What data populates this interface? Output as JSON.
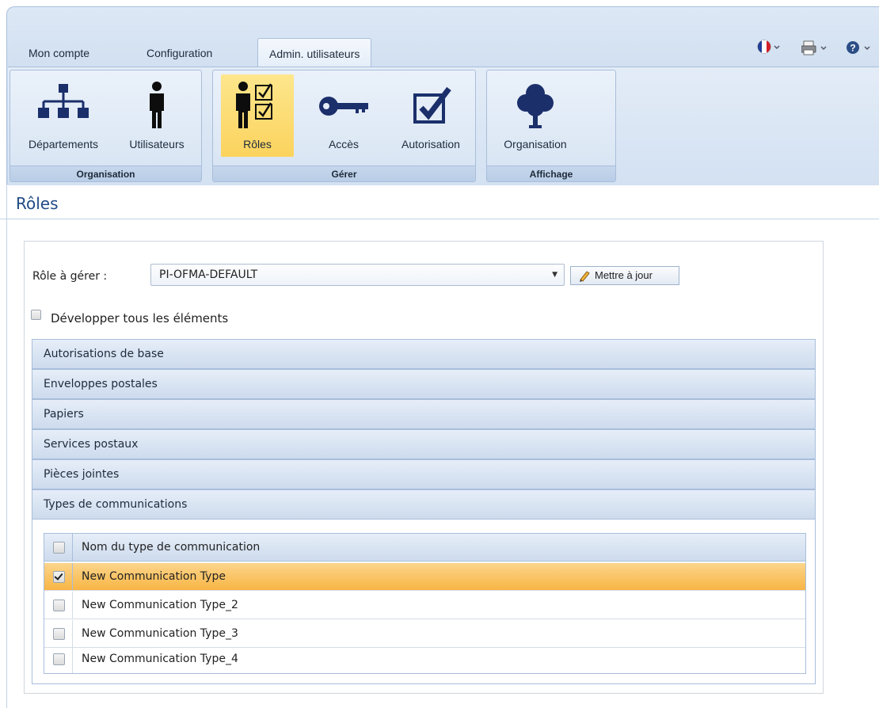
{
  "tabs": {
    "account": "Mon compte",
    "config": "Configuration",
    "admin": "Admin. utilisateurs"
  },
  "ribbon": {
    "groups": {
      "organisation": "Organisation",
      "manage": "Gérer",
      "display": "Affichage"
    },
    "buttons": {
      "departments": "Départements",
      "users": "Utilisateurs",
      "roles": "Rôles",
      "access": "Accès",
      "authorization": "Autorisation",
      "organization": "Organisation"
    }
  },
  "page": {
    "title": "Rôles"
  },
  "role": {
    "label": "Rôle à gérer :",
    "selected": "PI-OFMA-DEFAULT",
    "update_button": "Mettre à jour"
  },
  "expand_all": {
    "label": "Développer tous les éléments",
    "checked": false
  },
  "sections": [
    "Autorisations de base",
    "Enveloppes postales",
    "Papiers",
    "Services postaux",
    "Pièces jointes",
    "Types de communications"
  ],
  "comm_table": {
    "header": "Nom du type de communication",
    "rows": [
      {
        "name": "New Communication Type",
        "checked": true
      },
      {
        "name": "New Communication Type_2",
        "checked": false
      },
      {
        "name": "New Communication Type_3",
        "checked": false
      },
      {
        "name": "New Communication Type_4",
        "checked": false
      }
    ]
  },
  "colors": {
    "accent": "#1f4b85",
    "selected_row": "#f8b544",
    "ribbon_selected": "#fbd35e"
  },
  "icons": {
    "lang": "france-flag-icon",
    "print": "printer-icon",
    "help": "help-icon"
  }
}
